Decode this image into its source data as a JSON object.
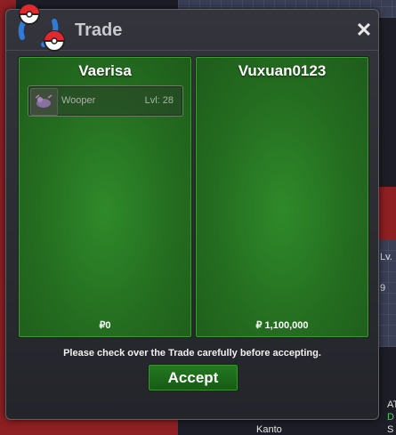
{
  "window": {
    "title": "Trade"
  },
  "left_panel": {
    "player": "Vaerisa",
    "money": "₽0",
    "items": [
      {
        "name": "Wooper",
        "level": "Lvl: 28"
      }
    ]
  },
  "right_panel": {
    "player": "Vuxuan0123",
    "money": "₽ 1,100,000"
  },
  "notice": "Please check over the Trade carefully before accepting.",
  "accept_label": "Accept",
  "background": {
    "side_labels": [
      "Lv.",
      "9",
      "AT",
      "D",
      "S"
    ],
    "bottom_label": "Kanto"
  },
  "colors": {
    "panel_green": "#246d20",
    "button_green": "#1d6a1a"
  }
}
